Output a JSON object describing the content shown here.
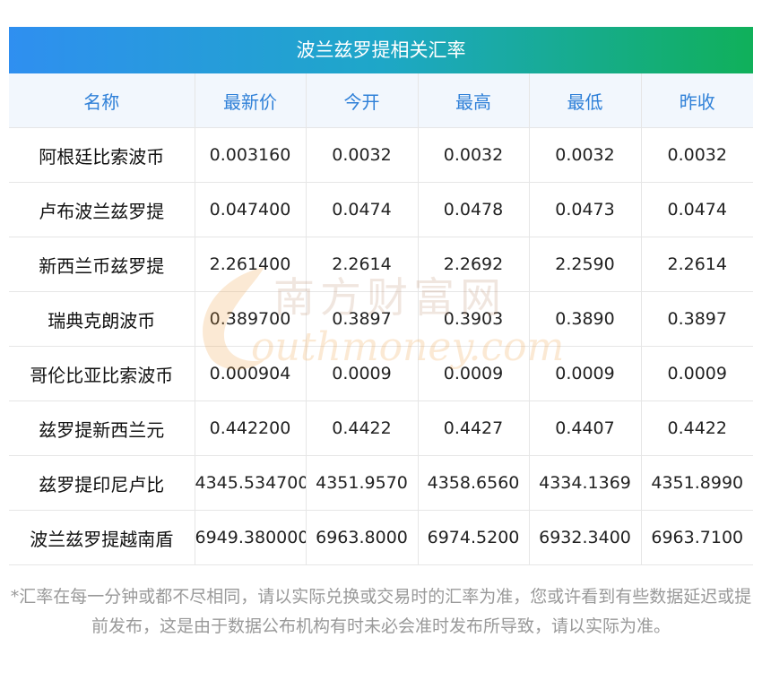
{
  "title": "波兰兹罗提相关汇率",
  "headers": [
    "名称",
    "最新价",
    "今开",
    "最高",
    "最低",
    "昨收"
  ],
  "rows": [
    [
      "阿根廷比索波币",
      "0.003160",
      "0.0032",
      "0.0032",
      "0.0032",
      "0.0032"
    ],
    [
      "卢布波兰兹罗提",
      "0.047400",
      "0.0474",
      "0.0478",
      "0.0473",
      "0.0474"
    ],
    [
      "新西兰币兹罗提",
      "2.261400",
      "2.2614",
      "2.2692",
      "2.2590",
      "2.2614"
    ],
    [
      "瑞典克朗波币",
      "0.389700",
      "0.3897",
      "0.3903",
      "0.3890",
      "0.3897"
    ],
    [
      "哥伦比亚比索波币",
      "0.000904",
      "0.0009",
      "0.0009",
      "0.0009",
      "0.0009"
    ],
    [
      "兹罗提新西兰元",
      "0.442200",
      "0.4422",
      "0.4427",
      "0.4407",
      "0.4422"
    ],
    [
      "兹罗提印尼卢比",
      "4345.534700",
      "4351.9570",
      "4358.6560",
      "4334.1369",
      "4351.8990"
    ],
    [
      "波兰兹罗提越南盾",
      "6949.380000",
      "6963.8000",
      "6974.5200",
      "6932.3400",
      "6963.7100"
    ]
  ],
  "watermark": {
    "cn": "南方财富网",
    "en": "outhmoney.com"
  },
  "footnote": "*汇率在每一分钟或都不尽相同，请以实际兑换或交易时的汇率为准，您或许看到有些数据延迟或提前发布，这是由于数据公布机构有时未必会准时发布所导致，请以实际为准。",
  "colors": {
    "title_gradient_start": "#2f8ff0",
    "title_gradient_end": "#10b05a",
    "header_bg": "#f2f7fd",
    "header_text": "#2f80d8",
    "watermark": "#f0a040"
  }
}
